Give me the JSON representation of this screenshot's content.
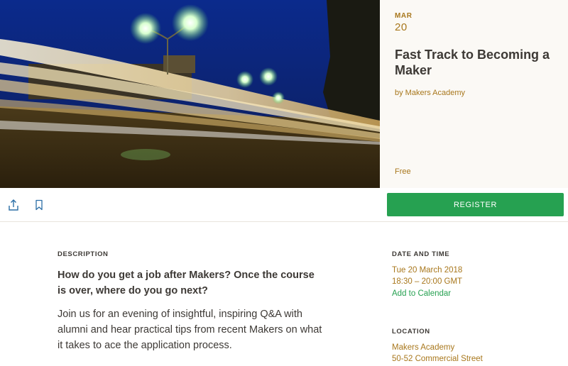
{
  "event": {
    "month": "MAR",
    "day": "20",
    "title": "Fast Track to Becoming a Maker",
    "organizer": "by Makers Academy",
    "price": "Free"
  },
  "actions": {
    "share_icon": "share-upload-icon",
    "save_icon": "bookmark-icon",
    "register_label": "REGISTER"
  },
  "description": {
    "label": "DESCRIPTION",
    "lead": "How do you get a job after Makers? Once the course is over, where do you go next?",
    "body": "Join us for an evening of insightful, inspiring Q&A with alumni and hear practical tips from recent Makers on what it takes to ace the application process."
  },
  "date_time": {
    "label": "DATE AND TIME",
    "date": "Tue 20 March 2018",
    "time": "18:30 – 20:00 GMT",
    "add_to_calendar": "Add to Calendar"
  },
  "location": {
    "label": "LOCATION",
    "lines": [
      "Makers Academy",
      "50-52 Commercial Street"
    ]
  },
  "colors": {
    "accent_gold": "#a8771c",
    "register_green": "#26a151",
    "text_dark": "#3d3935",
    "panel_bg": "#fbf9f5"
  }
}
